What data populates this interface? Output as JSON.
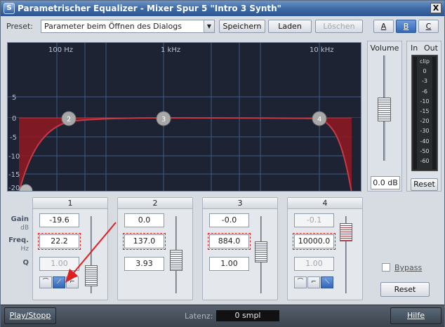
{
  "window": {
    "title": "Parametrischer Equalizer - Mixer Spur 5 \"Intro 3 Synth\"",
    "close_glyph": "X",
    "logo_glyph": "S"
  },
  "preset": {
    "label": "Preset:",
    "value": "Parameter beim Öffnen des Dialogs",
    "save_label": "Speichern",
    "load_label": "Laden",
    "delete_label": "Löschen",
    "ab_buttons": [
      {
        "label": "A",
        "selected": false
      },
      {
        "label": "B",
        "selected": true
      },
      {
        "label": "C",
        "selected": false
      }
    ]
  },
  "graph": {
    "freq_labels": [
      "100 Hz",
      "1 kHz",
      "10 kHz"
    ],
    "db_labels": [
      "5",
      "0",
      "-5",
      "-10",
      "-15",
      "-20"
    ],
    "band_markers": [
      "2",
      "3",
      "4"
    ],
    "colors": {
      "background": "#1d2333",
      "grid": "#3a5e8a",
      "fill": "#8b1a22",
      "curve": "#c43a46"
    }
  },
  "volume": {
    "label": "Volume",
    "value": "0.0 dB"
  },
  "meter": {
    "in_label": "In",
    "out_label": "Out",
    "scale": [
      "clip",
      "0",
      "-3",
      "-6",
      "-10",
      "-15",
      "-20",
      "-30",
      "-40",
      "-50",
      "-60"
    ],
    "reset_label": "Reset"
  },
  "rows": {
    "gain": "Gain",
    "gain_unit": "dB",
    "freq": "Freq.",
    "freq_unit": "Hz",
    "q": "Q"
  },
  "bands": [
    {
      "header": "1",
      "gain": "-19.6",
      "freq": "22.2",
      "q": "1.00",
      "gain_enabled": true,
      "q_enabled": false
    },
    {
      "header": "2",
      "gain": "0.0",
      "freq": "137.0",
      "q": "3.93",
      "gain_enabled": true,
      "q_enabled": true
    },
    {
      "header": "3",
      "gain": "-0.0",
      "freq": "884.0",
      "q": "1.00",
      "gain_enabled": true,
      "q_enabled": true
    },
    {
      "header": "4",
      "gain": "-0.1",
      "freq": "10000.0",
      "q": "1.00",
      "gain_enabled": false,
      "q_enabled": false
    }
  ],
  "bypass": {
    "label": "Bypass",
    "checked": false
  },
  "reset_label": "Reset",
  "bottom": {
    "play_label": "Play/Stopp",
    "latency_label": "Latenz:",
    "latency_value": "0 smpl",
    "help_label": "Hilfe"
  }
}
